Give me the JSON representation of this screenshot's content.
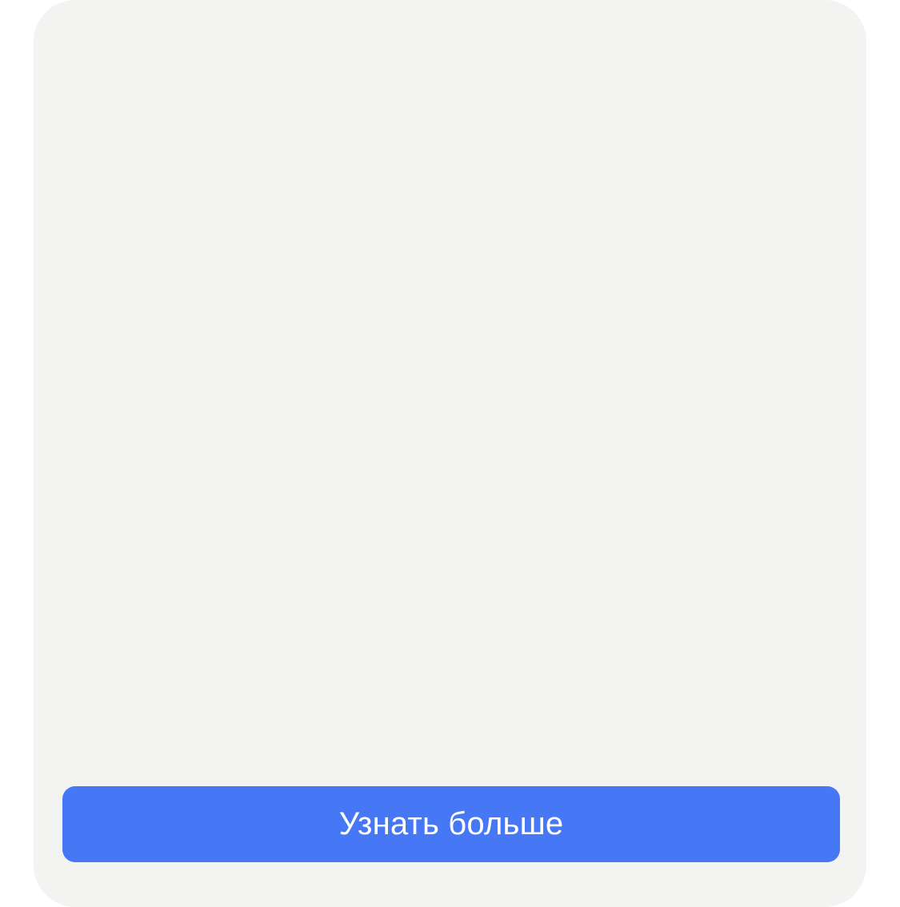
{
  "colors": {
    "card_background": "#f3f3f2",
    "button_background": "#4677f5",
    "button_text": "#ffffff"
  },
  "card": {
    "cta_label": "Узнать больше"
  }
}
